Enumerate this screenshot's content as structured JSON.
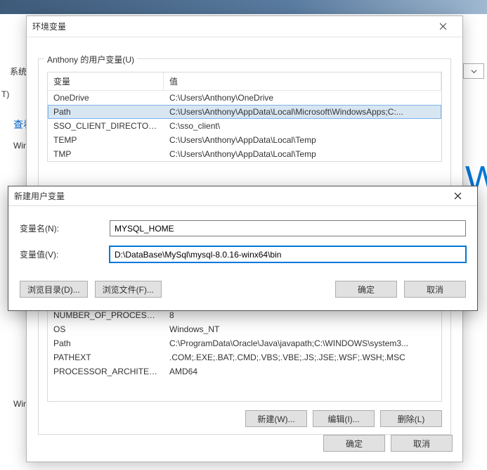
{
  "bg": {
    "sys": "系统",
    "t": "T)",
    "look": "查看",
    "win": "Win",
    "W": "W",
    "win2": "Win"
  },
  "envDialog": {
    "title": "环境变量",
    "userGroupLabel": "Anthony 的用户变量(U)",
    "columns": {
      "var": "变量",
      "val": "值"
    },
    "userVars": [
      {
        "name": "OneDrive",
        "value": "C:\\Users\\Anthony\\OneDrive"
      },
      {
        "name": "Path",
        "value": "C:\\Users\\Anthony\\AppData\\Local\\Microsoft\\WindowsApps;C:..."
      },
      {
        "name": "SSO_CLIENT_DIRECTORY",
        "value": "C:\\sso_client\\"
      },
      {
        "name": "TEMP",
        "value": "C:\\Users\\Anthony\\AppData\\Local\\Temp"
      },
      {
        "name": "TMP",
        "value": "C:\\Users\\Anthony\\AppData\\Local\\Temp"
      }
    ],
    "sysVars": [
      {
        "name": "NUMBER_OF_PROCESSORS",
        "value": "8"
      },
      {
        "name": "OS",
        "value": "Windows_NT"
      },
      {
        "name": "Path",
        "value": "C:\\ProgramData\\Oracle\\Java\\javapath;C:\\WINDOWS\\system3..."
      },
      {
        "name": "PATHEXT",
        "value": ".COM;.EXE;.BAT;.CMD;.VBS;.VBE;.JS;.JSE;.WSF;.WSH;.MSC"
      },
      {
        "name": "PROCESSOR_ARCHITECT...",
        "value": "AMD64"
      }
    ],
    "buttons": {
      "new": "新建(W)...",
      "edit": "编辑(I)...",
      "delete": "删除(L)"
    },
    "okcancel": {
      "ok": "确定",
      "cancel": "取消"
    }
  },
  "newVarDialog": {
    "title": "新建用户变量",
    "nameLabel": "变量名(N):",
    "valueLabel": "变量值(V):",
    "nameValue": "MYSQL_HOME",
    "valueValue": "D:\\DataBase\\MySql\\mysql-8.0.16-winx64\\bin",
    "browseDir": "浏览目录(D)...",
    "browseFile": "浏览文件(F)...",
    "ok": "确定",
    "cancel": "取消"
  }
}
